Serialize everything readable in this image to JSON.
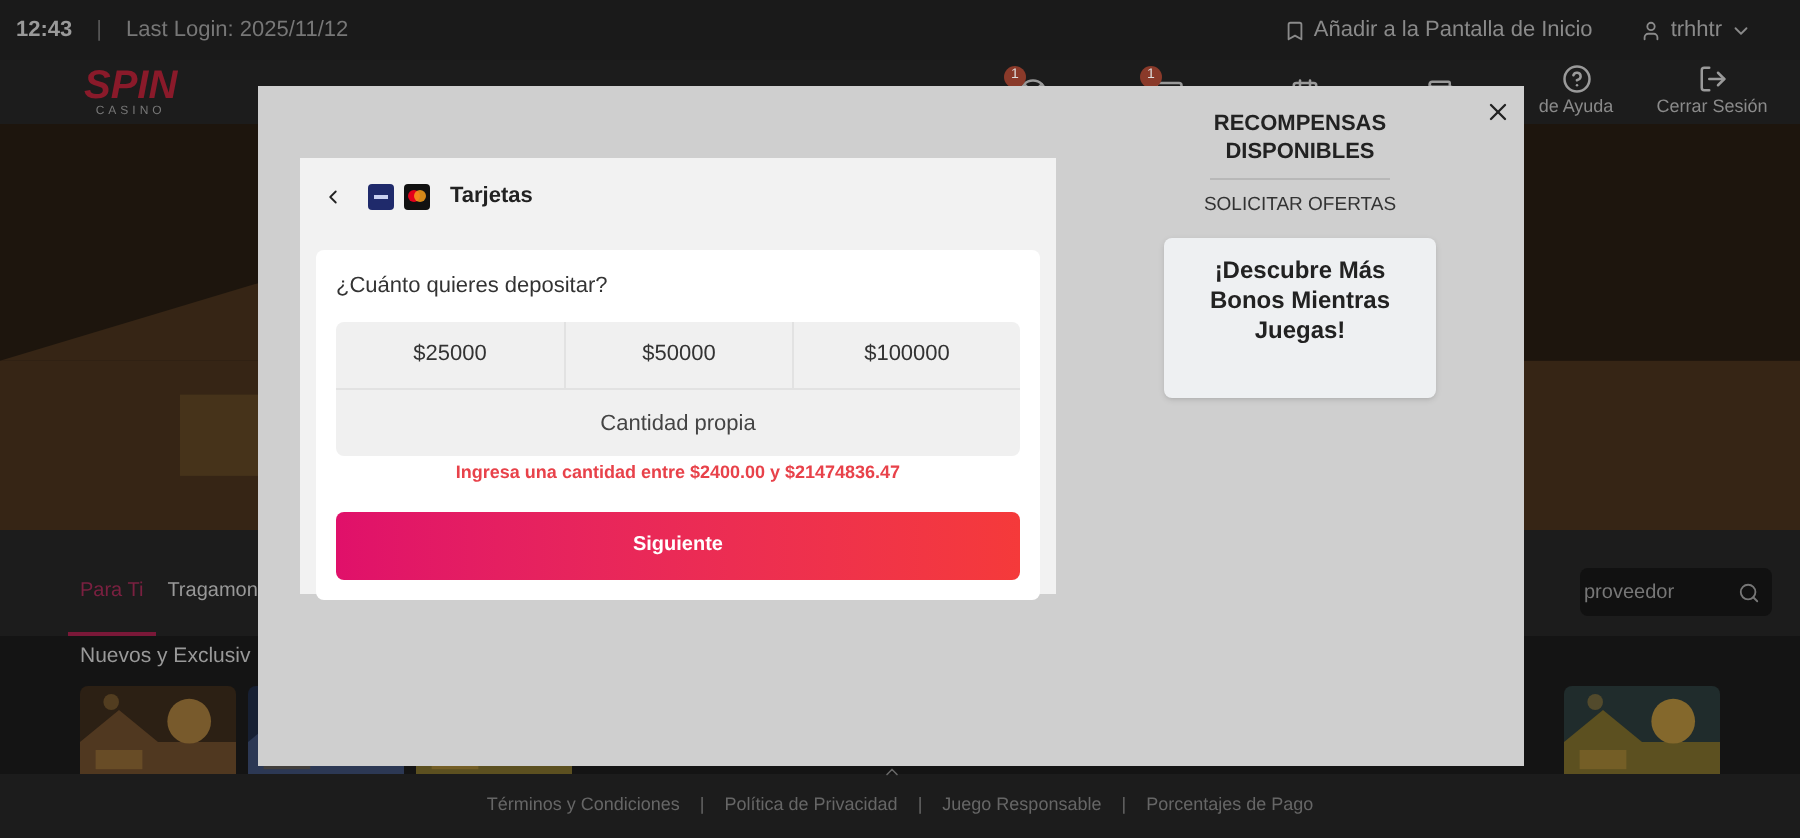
{
  "top_bar": {
    "time": "12:43",
    "separator": "|",
    "last_login": "Last Login: 2025/11/12",
    "add_home": "Añadir a la Pantalla de Inicio",
    "user": "trhhtr"
  },
  "header": {
    "logo_main": "SPIN",
    "logo_sub": "CASINO",
    "nav": [
      {
        "kind": "wheel",
        "badge": "1"
      },
      {
        "kind": "mail",
        "badge": "1"
      },
      {
        "kind": "calendar"
      },
      {
        "kind": "wallet"
      },
      {
        "kind": "help",
        "label": "de Ayuda"
      },
      {
        "kind": "logout",
        "label": "Cerrar Sesión"
      }
    ]
  },
  "tabs": [
    {
      "label": "Para Ti",
      "selected": true
    },
    {
      "label": "Tragamon",
      "selected": false
    }
  ],
  "search": {
    "placeholder": "proveedor"
  },
  "section": {
    "title": "Nuevos y Exclusiv"
  },
  "footer": {
    "links": [
      "Términos y Condiciones",
      "Política de Privacidad",
      "Juego Responsable",
      "Porcentajes de Pago"
    ],
    "separator": "|"
  },
  "modal": {
    "payment": {
      "title": "Tarjetas",
      "question": "¿Cuánto quieres depositar?",
      "amounts": [
        {
          "label": "$25000",
          "selected": false
        },
        {
          "label": "$50000",
          "selected": false
        },
        {
          "label": "$100000",
          "selected": false
        }
      ],
      "custom_placeholder": "Cantidad propia",
      "error": "Ingresa una cantidad entre $2400.00 y $21474836.47",
      "submit": "Siguiente"
    },
    "rewards": {
      "title": "RECOMPENSAS DISPONIBLES",
      "tab": "SOLICITAR OFERTAS",
      "card": "¡Descubre Más Bonos Mientras Juegas!"
    }
  }
}
